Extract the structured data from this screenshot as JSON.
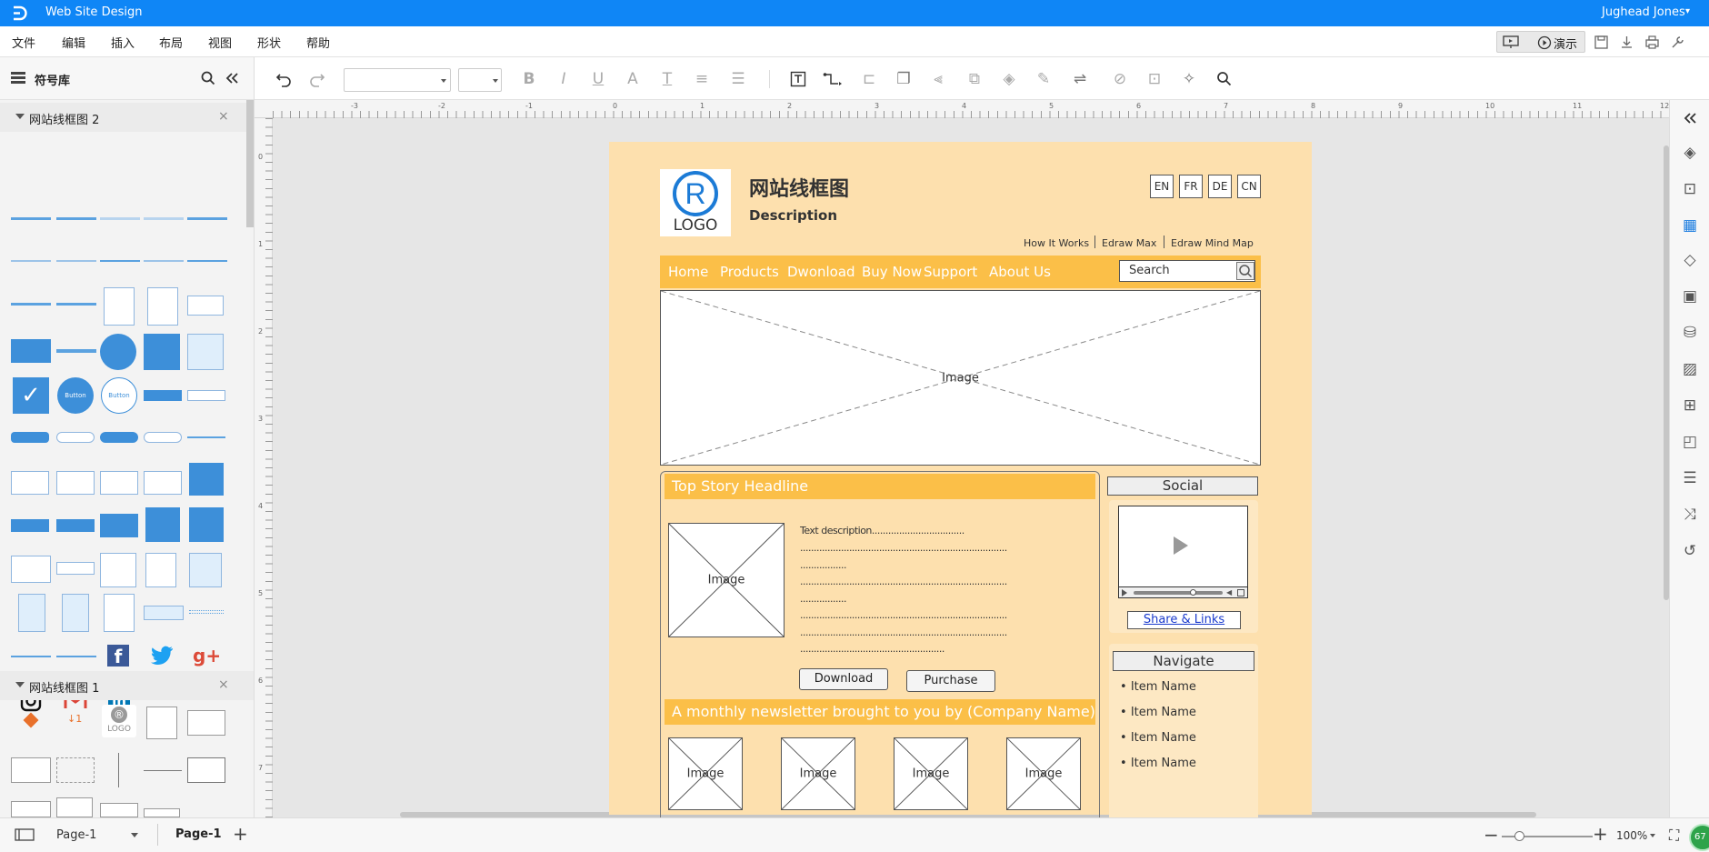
{
  "titlebar": {
    "title": "Web Site Design",
    "user": "Jughead Jones",
    "user_arrow": "▾"
  },
  "menubar": {
    "items": [
      "文件",
      "编辑",
      "插入",
      "布局",
      "视图",
      "形状",
      "帮助"
    ],
    "present_label": "演示"
  },
  "sidebar": {
    "title": "符号库",
    "lib1": {
      "title": "网站线框图 2",
      "button_label": "Button",
      "button_sub": "Button"
    },
    "lib2": {
      "title": "网站线框图 1",
      "arrow_label": "↓1",
      "logo_label": "LOGO"
    }
  },
  "canvas": {
    "ruler_x": [
      "-3",
      "-2",
      "-1",
      "0",
      "1",
      "2",
      "3",
      "4",
      "5",
      "6",
      "7",
      "8",
      "9",
      "10",
      "11",
      "12"
    ],
    "ruler_y": [
      "0",
      "1",
      "2",
      "3",
      "4",
      "5",
      "6",
      "7"
    ]
  },
  "wireframe": {
    "logo_text": "LOGO",
    "site_title": "网站线框图",
    "description": "Description",
    "languages": [
      "EN",
      "FR",
      "DE",
      "CN"
    ],
    "top_links": [
      "How It Works",
      "Edraw Max",
      "Edraw Mind Map"
    ],
    "nav": [
      "Home",
      "Products",
      "Dwonload",
      "Buy Now",
      "Support",
      "About Us"
    ],
    "search_placeholder": "Search",
    "hero_label": "Image",
    "top_story": "Top Story Headline",
    "story_image": "Image",
    "text_description": "Text description..................................",
    "dotted_lines": [
      "............................................................................",
      ".................",
      "............................................................................",
      ".................",
      "............................................................................",
      "............................................................................",
      "....................................................."
    ],
    "download_label": "Download",
    "purchase_label": "Purchase",
    "newsletter": "A monthly newsletter brought to you by (Company Name)",
    "newsletter_images": [
      "Image",
      "Image",
      "Image",
      "Image"
    ],
    "social_title": "Social",
    "share_links": "Share & Links",
    "navigate_title": "Navigate",
    "navigate_items": [
      "Item Name",
      "Item Name",
      "Item Name",
      "Item Name"
    ]
  },
  "statusbar": {
    "page_select": "Page-1",
    "page_tab": "Page-1",
    "zoom": "100%",
    "badge": "67"
  },
  "colors": {
    "accent": "#0f86f6",
    "page_bg": "#fde0ae",
    "orange": "#fbbf48",
    "thumb_blue": "#3d8fd9"
  }
}
